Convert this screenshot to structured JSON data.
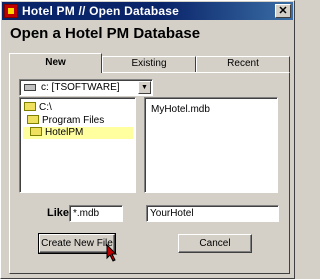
{
  "window": {
    "title": "Hotel PM // Open Database",
    "close_label": "✕"
  },
  "heading": "Open a Hotel PM Database",
  "tabs": [
    {
      "label": "New",
      "active": true
    },
    {
      "label": "Existing",
      "active": false
    },
    {
      "label": "Recent",
      "active": false
    }
  ],
  "drive": {
    "selected": "c: [TSOFTWARE]",
    "icon": "drive-icon"
  },
  "directories": [
    {
      "label": "C:\\",
      "selected": false
    },
    {
      "label": "Program Files",
      "selected": false
    },
    {
      "label": "HotelPM",
      "selected": true
    }
  ],
  "files": [
    "MyHotel.mdb"
  ],
  "form": {
    "like_label": "Like",
    "like_value": "*.mdb",
    "name_value": "YourHotel"
  },
  "buttons": {
    "create": "Create New File",
    "cancel": "Cancel"
  }
}
